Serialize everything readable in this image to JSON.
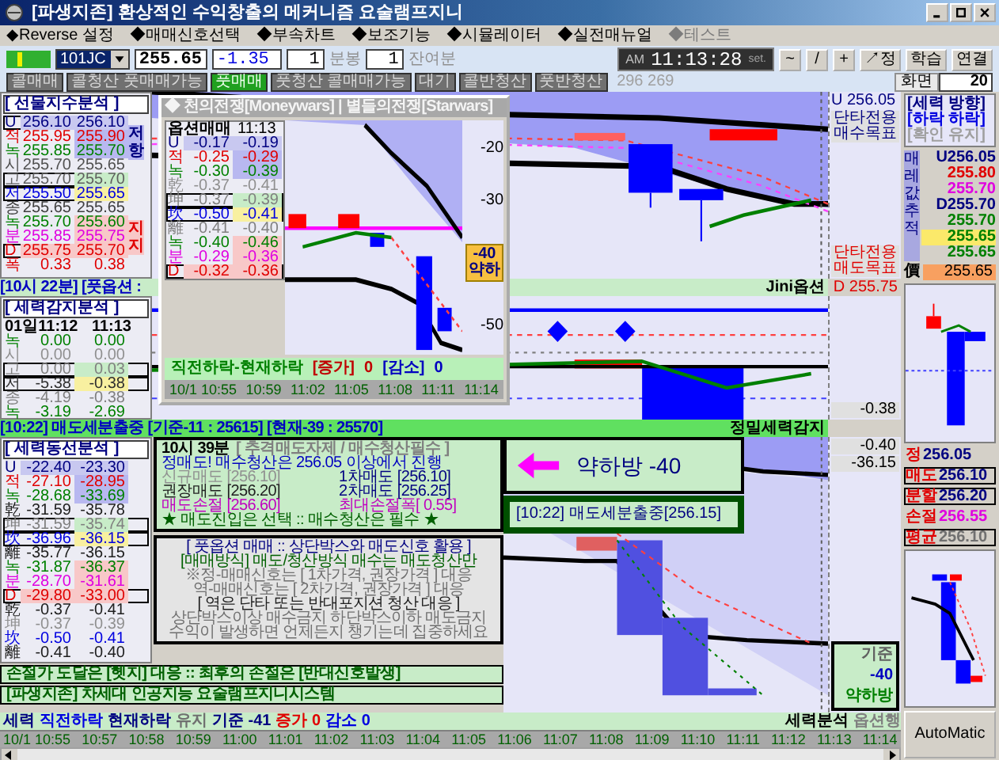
{
  "window": {
    "title": "[파생지존] 환상적인 수익창출의 메커니즘 요술램프지니"
  },
  "menu": [
    {
      "label": "◆Reverse 설정",
      "disabled": false
    },
    {
      "label": "◆매매신호선택",
      "disabled": false
    },
    {
      "label": "◆부속차트",
      "disabled": false
    },
    {
      "label": "◆보조기능",
      "disabled": false
    },
    {
      "label": "◆시뮬레이터",
      "disabled": false
    },
    {
      "label": "◆실전매뉴얼",
      "disabled": false
    },
    {
      "label": "◆테스트",
      "disabled": true
    }
  ],
  "toolbar": {
    "symbol": "101JC",
    "price": "255.65",
    "change": "-1.35",
    "bar_value": "1",
    "bar_label": "분봉",
    "remaining_value": "1",
    "remaining_label": "잔여분",
    "clock_ampm": "AM",
    "clock_time": "11:13:28",
    "clock_set": "set.",
    "buttons": [
      "~",
      "/",
      "+",
      "↗정",
      "학습",
      "연결"
    ]
  },
  "signals": [
    {
      "label": "콜매매",
      "selected": false
    },
    {
      "label": "콜청산 풋매매가능",
      "selected": false
    },
    {
      "label": "풋매매",
      "selected": true
    },
    {
      "label": "풋청산 콜매매가능",
      "selected": false
    },
    {
      "label": "대기",
      "selected": false
    },
    {
      "label": "콜반청산",
      "selected": false
    },
    {
      "label": "풋반청산",
      "selected": false
    }
  ],
  "signal_count": "296 269",
  "screen": {
    "label": "화면",
    "value": "20"
  },
  "index_panel": {
    "title": "[ 선물지수분석 ]",
    "side_tags": [
      "저항",
      "지지"
    ],
    "rows": [
      {
        "label": "U",
        "values": [
          {
            "text": "256.10",
            "color": "#c8c8f0"
          },
          {
            "text": "256.10",
            "color": "#c8c8f0"
          }
        ],
        "color": "#000080",
        "boxed": true
      },
      {
        "label": "적",
        "values": [
          {
            "text": "255.95"
          },
          {
            "text": "255.90",
            "color": "#b8b8f0"
          }
        ],
        "color": "#e00000",
        "boxed": false
      },
      {
        "label": "녹",
        "values": [
          {
            "text": "255.85"
          },
          {
            "text": "255.70",
            "color": "#b8b8f0"
          }
        ],
        "color": "#008000",
        "boxed": false
      },
      {
        "label": "시",
        "values": [
          {
            "text": "255.70"
          },
          {
            "text": "255.65"
          }
        ],
        "color": "#505050",
        "boxed": false
      },
      {
        "label": "고",
        "values": [
          {
            "text": "255.70"
          },
          {
            "text": "255.70",
            "color": "#c8ecc8"
          }
        ],
        "color": "#606060",
        "boxed": true
      },
      {
        "label": "저",
        "values": [
          {
            "text": "255.50"
          },
          {
            "text": "255.65",
            "color": "#f8f0a0"
          }
        ],
        "color": "#0000e0",
        "boxed": true
      },
      {
        "label": "종",
        "values": [
          {
            "text": "255.65"
          },
          {
            "text": "255.65"
          }
        ],
        "color": "#404040",
        "boxed": false
      },
      {
        "label": "녹",
        "values": [
          {
            "text": "255.70"
          },
          {
            "text": "255.60",
            "color": "#f8c8c8"
          }
        ],
        "color": "#008000",
        "boxed": false
      },
      {
        "label": "분",
        "values": [
          {
            "text": "255.85"
          },
          {
            "text": "255.75",
            "color": "#f8c8c8"
          }
        ],
        "color": "#e000e0",
        "boxed": false
      },
      {
        "label": "D",
        "values": [
          {
            "text": "255.75",
            "color": "#f8c8c8"
          },
          {
            "text": "255.70",
            "color": "#f8c8c8"
          }
        ],
        "color": "#e00000",
        "boxed": true
      },
      {
        "label": "폭",
        "values": [
          {
            "text": "0.33"
          },
          {
            "text": "0.38"
          }
        ],
        "color": "#e00000",
        "boxed": false
      }
    ]
  },
  "index_strip": "[10시 22분] [풋옵션 :",
  "main_scale": {
    "top": "U 256.05",
    "buy_target": "단타전용 매수목표",
    "sell_target": "단타전용 매도목표",
    "strip_label": "Jini옵션",
    "strip_value": "D 255.75"
  },
  "power_panel": {
    "title": "[ 세력감지분석 ]",
    "header": [
      "01일11:12",
      "11:13"
    ],
    "rows": [
      {
        "label": "녹",
        "values": [
          {
            "text": "0.00"
          },
          {
            "text": "0.00"
          }
        ],
        "color": "#008000",
        "boxed": false
      },
      {
        "label": "시",
        "values": [
          {
            "text": "0.00"
          },
          {
            "text": "0.00"
          }
        ],
        "color": "#909090",
        "boxed": false
      },
      {
        "label": "고",
        "values": [
          {
            "text": "0.00"
          },
          {
            "text": "0.03",
            "color": "#c8ecc8"
          }
        ],
        "color": "#808080",
        "boxed": true
      },
      {
        "label": "저",
        "values": [
          {
            "text": "-5.38"
          },
          {
            "text": "-0.38",
            "color": "#f8f0a0"
          }
        ],
        "color": "#303030",
        "boxed": true
      },
      {
        "label": "종",
        "values": [
          {
            "text": "-4.19"
          },
          {
            "text": "-0.38"
          }
        ],
        "color": "#808080",
        "boxed": false
      },
      {
        "label": "녹",
        "values": [
          {
            "text": "-3.19"
          },
          {
            "text": "-2.69"
          }
        ],
        "color": "#008000",
        "boxed": false
      }
    ]
  },
  "power_scale": {
    "value": "-0.38"
  },
  "alert_strip": {
    "text": "[10:22] 매도세분출중 [기준-11 : 25615] [현재-39 : 25570]",
    "label": "정밀세력감지"
  },
  "flow_panel": {
    "title": "[ 세력동선분석 ]",
    "rows": [
      {
        "label": "U",
        "values": [
          {
            "text": "-22.40",
            "color": "#c8c8f0"
          },
          {
            "text": "-23.30",
            "color": "#c8c8f0"
          }
        ],
        "color": "#000080",
        "boxed": false
      },
      {
        "label": "적",
        "values": [
          {
            "text": "-27.10"
          },
          {
            "text": "-28.95",
            "color": "#b8b8f0"
          }
        ],
        "color": "#e00000",
        "boxed": false
      },
      {
        "label": "녹",
        "values": [
          {
            "text": "-28.68"
          },
          {
            "text": "-33.69",
            "color": "#b8b8f0"
          }
        ],
        "color": "#008000",
        "boxed": false
      },
      {
        "label": "乾",
        "values": [
          {
            "text": "-31.59"
          },
          {
            "text": "-35.78"
          }
        ],
        "color": "#202020",
        "boxed": false
      },
      {
        "label": "坤",
        "values": [
          {
            "text": "-31.59"
          },
          {
            "text": "-35.74",
            "color": "#c8ecc8"
          }
        ],
        "color": "#808080",
        "boxed": true
      },
      {
        "label": "坎",
        "values": [
          {
            "text": "-36.96"
          },
          {
            "text": "-36.15",
            "color": "#f8f0a0"
          }
        ],
        "color": "#0000e0",
        "boxed": true
      },
      {
        "label": "離",
        "values": [
          {
            "text": "-35.77"
          },
          {
            "text": "-36.15"
          }
        ],
        "color": "#202020",
        "boxed": false
      },
      {
        "label": "녹",
        "values": [
          {
            "text": "-31.87"
          },
          {
            "text": "-36.37",
            "color": "#f8c8c8"
          }
        ],
        "color": "#008000",
        "boxed": false
      },
      {
        "label": "분",
        "values": [
          {
            "text": "-28.70"
          },
          {
            "text": "-31.61",
            "color": "#f8c8c8"
          }
        ],
        "color": "#e000e0",
        "boxed": false
      },
      {
        "label": "D",
        "values": [
          {
            "text": "-29.80",
            "color": "#f8c8c8"
          },
          {
            "text": "-33.00",
            "color": "#f8c8c8"
          }
        ],
        "color": "#e00000",
        "boxed": true
      },
      {
        "label": "乾",
        "values": [
          {
            "text": "-0.37"
          },
          {
            "text": "-0.41"
          }
        ],
        "color": "#202020",
        "boxed": false
      },
      {
        "label": "坤",
        "values": [
          {
            "text": "-0.37"
          },
          {
            "text": "-0.39"
          }
        ],
        "color": "#909090",
        "boxed": false
      },
      {
        "label": "坎",
        "values": [
          {
            "text": "-0.50"
          },
          {
            "text": "-0.41"
          }
        ],
        "color": "#0000e0",
        "boxed": false
      },
      {
        "label": "離",
        "values": [
          {
            "text": "-0.41"
          },
          {
            "text": "-0.40"
          }
        ],
        "color": "#202020",
        "boxed": false
      }
    ]
  },
  "advice": {
    "heading_time": "10시 39분",
    "heading_note": "[ 추격매도자제 / 매수청산필수 ]",
    "lines": [
      {
        "cells": [
          {
            "text": "정매도! 매수청산은 256.05 이상에서 진행",
            "color": "#0000c0"
          }
        ]
      },
      {
        "cells": [
          {
            "text": "신규매도 [256.10]",
            "color": "#909090"
          },
          {
            "text": "1차매도 [256.10]",
            "color": "#000080"
          }
        ]
      },
      {
        "cells": [
          {
            "text": "권장매도 [256.20]",
            "color": "#202020"
          },
          {
            "text": "2차매도 [256.25]",
            "color": "#000080"
          }
        ]
      },
      {
        "cells": [
          {
            "text": "매도손절 [256.60]",
            "color": "#c000c0"
          },
          {
            "text": "최대손절폭[ 0.55]",
            "color": "#c000c0"
          }
        ]
      },
      {
        "cells": [
          {
            "text": "★ 매도진입은 선택 :: 매수청산은 필수 ★",
            "color": "#006000"
          }
        ]
      }
    ]
  },
  "guide": [
    {
      "text": "[ 풋옵션 매매 :: 상단박스와 매도신호 활용 ]",
      "color": "#000080"
    },
    {
      "text": "[매매방식] 매도/청산방식 매수는 매도청산만",
      "color": "#006000"
    },
    {
      "text": "※정-매매신호는 [ 1차가격, 권장가격 ] 대응",
      "color": "#707070"
    },
    {
      "text": "역-매매신호는 [ 2차가격, 권장가격 ] 대응",
      "color": "#707070"
    },
    {
      "text": "[ 역은 단타 또는 반대포지션 청산 대응 ]",
      "color": "#202020"
    },
    {
      "text": "상단박스이상 매수금지 하단박스이하 매도금지",
      "color": "#707070"
    },
    {
      "text": "수익이 발생하면 언제든지 챙기는데 집중하세요",
      "color": "#707070"
    }
  ],
  "notices": [
    "손절가 도달은 [헷지] 대응 :: 최후의 손절은 [반대신호발생]",
    "[파생지존] 차세대 인공지능 요술램프지니시스템"
  ],
  "flow_chart": {
    "trend": "약하방 -40",
    "signal": "[10:22] 매도세분출중[256.15]"
  },
  "flow_scale": {
    "values": [
      "-0.40",
      "-36.15"
    ],
    "base_box": [
      "기준",
      "-40",
      "약하방"
    ]
  },
  "popup": {
    "title": "◆ 천의전쟁[Moneywars] | 별들의전쟁[Starwars]",
    "header": [
      "옵션매매",
      "11:13"
    ],
    "rows": [
      {
        "label": "U",
        "values": [
          {
            "text": "-0.17",
            "color": "#c8c8f0"
          },
          {
            "text": "-0.19",
            "color": "#c8c8f0"
          }
        ],
        "color": "#000080",
        "boxed": false
      },
      {
        "label": "적",
        "values": [
          {
            "text": "-0.25"
          },
          {
            "text": "-0.29",
            "color": "#b8b8f0"
          }
        ],
        "color": "#e00000",
        "boxed": false
      },
      {
        "label": "녹",
        "values": [
          {
            "text": "-0.30"
          },
          {
            "text": "-0.39",
            "color": "#b8b8f0"
          }
        ],
        "color": "#008000",
        "boxed": false
      },
      {
        "label": "乾",
        "values": [
          {
            "text": "-0.37"
          },
          {
            "text": "-0.41"
          }
        ],
        "color": "#909090",
        "boxed": false
      },
      {
        "label": "坤",
        "values": [
          {
            "text": "-0.37"
          },
          {
            "text": "-0.39",
            "color": "#c8ecc8"
          }
        ],
        "color": "#808080",
        "boxed": true
      },
      {
        "label": "坎",
        "values": [
          {
            "text": "-0.50"
          },
          {
            "text": "-0.41",
            "color": "#f8f0a0"
          }
        ],
        "color": "#0000e0",
        "boxed": true
      },
      {
        "label": "離",
        "values": [
          {
            "text": "-0.41"
          },
          {
            "text": "-0.40"
          }
        ],
        "color": "#808080",
        "boxed": false
      },
      {
        "label": "녹",
        "values": [
          {
            "text": "-0.40"
          },
          {
            "text": "-0.46",
            "color": "#f8c8c8"
          }
        ],
        "color": "#008000",
        "boxed": false
      },
      {
        "label": "분",
        "values": [
          {
            "text": "-0.29"
          },
          {
            "text": "-0.36",
            "color": "#f8c8c8"
          }
        ],
        "color": "#e000e0",
        "boxed": false
      },
      {
        "label": "D",
        "values": [
          {
            "text": "-0.32",
            "color": "#f8c8c8"
          },
          {
            "text": "-0.36",
            "color": "#f8c8c8"
          }
        ],
        "color": "#e00000",
        "boxed": true
      }
    ],
    "axis": [
      {
        "kind": "tick",
        "text": "-20"
      },
      {
        "kind": "tick",
        "text": "-30"
      },
      {
        "kind": "tag",
        "text": "-40",
        "note": "약하"
      },
      {
        "kind": "tick",
        "text": "-50"
      }
    ],
    "strip": [
      {
        "text": "직전하락-현재하락",
        "color": "#008000"
      },
      {
        "text": "[증가]",
        "color": "#c00000"
      },
      {
        "text": "0",
        "color": "#c00000"
      },
      {
        "text": "[감소]",
        "color": "#0000c0"
      },
      {
        "text": "0",
        "color": "#0000c0"
      }
    ],
    "times": [
      "10/1 10:55",
      "10:59",
      "11:02",
      "11:05",
      "11:08",
      "11:11",
      "11:14"
    ]
  },
  "direction": {
    "title": "[세력 방향]",
    "state": "[하락 하락]",
    "confirm": "[확인 유지]"
  },
  "trace": {
    "label": "매레값추적",
    "rows": [
      {
        "text": "U256.05",
        "color": "#000080",
        "highlighted": false
      },
      {
        "text": "255.80",
        "color": "#e00000",
        "highlighted": false
      },
      {
        "text": "255.70",
        "color": "#e000e0",
        "highlighted": false
      },
      {
        "text": "D255.70",
        "color": "#000080",
        "highlighted": false
      },
      {
        "text": "255.70",
        "color": "#008000",
        "highlighted": false
      },
      {
        "text": "255.65",
        "highlighted": true
      },
      {
        "text": "255.65",
        "color": "#008000",
        "highlighted": false
      }
    ]
  },
  "price_tag": {
    "label": "價",
    "value": "255.65"
  },
  "orders": [
    {
      "label": "정",
      "value": "256.05",
      "color": "#000080",
      "boxed": false
    },
    {
      "label": "매도",
      "value": "256.10",
      "color": "#000080",
      "boxed": true
    },
    {
      "label": "분할",
      "value": "256.20",
      "color": "#000080",
      "boxed": true
    },
    {
      "label": "손절",
      "value": "256.55",
      "color": "#e000e0",
      "boxed": false
    },
    {
      "label": "평균",
      "value": "256.10",
      "color": "#707070",
      "boxed": true
    }
  ],
  "status_left": [
    {
      "text": "세력",
      "color": "#000080"
    },
    {
      "text": "직전하락",
      "color": "#0000e0"
    },
    {
      "text": "현재하락",
      "color": "#000080"
    },
    {
      "text": "유지",
      "color": "#707070"
    },
    {
      "text": "기준 -41",
      "color": "#000080"
    },
    {
      "text": "증가 0",
      "color": "#e00000"
    },
    {
      "text": "감소 0",
      "color": "#0000e0"
    }
  ],
  "status_right": [
    {
      "text": "세력분석",
      "color": "#000000"
    },
    {
      "text": "옵션행",
      "color": "#808080"
    }
  ],
  "times": [
    "10/1 10:55",
    "10:57",
    "10:58",
    "10:59",
    "11:00",
    "11:01",
    "11:02",
    "11:03",
    "11:04",
    "11:05",
    "11:06",
    "11:07",
    "11:08",
    "11:09",
    "11:10",
    "11:11",
    "11:12",
    "11:13",
    "11:14"
  ],
  "auto_button": "AutoMatic"
}
